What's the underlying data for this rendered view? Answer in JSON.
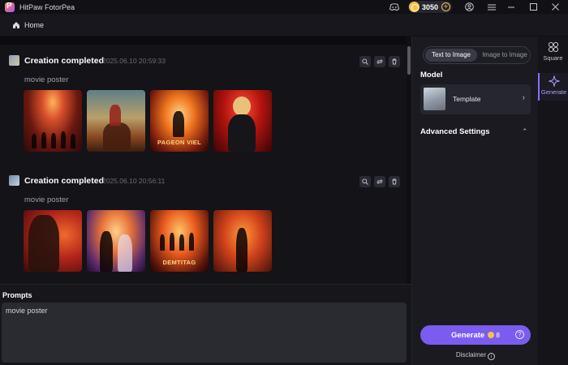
{
  "app": {
    "title": "HitPaw FotorPea",
    "coins": "3050"
  },
  "nav": {
    "home_label": "Home"
  },
  "feed": {
    "cards": [
      {
        "title": "Creation completed",
        "timestamp": "2025.06.10   20:59:33",
        "prompt": "movie poster",
        "images": [
          {
            "icon": "theater-stage-image",
            "caption": ""
          },
          {
            "icon": "cowboy-horse-image",
            "caption": ""
          },
          {
            "icon": "fire-poster-image",
            "caption": "PAGEON VIEL"
          },
          {
            "icon": "woman-red-jacket-image",
            "caption": ""
          }
        ]
      },
      {
        "title": "Creation completed",
        "timestamp": "2025.06.10   20:56:11",
        "prompt": "movie poster",
        "images": [
          {
            "icon": "man-portrait-image",
            "caption": ""
          },
          {
            "icon": "couple-sunset-image",
            "caption": ""
          },
          {
            "icon": "crowd-fire-image",
            "caption": "DEMTITAG"
          },
          {
            "icon": "woman-fire-image",
            "caption": ""
          }
        ]
      }
    ]
  },
  "prompts": {
    "label": "Prompts",
    "value": "movie poster"
  },
  "panel": {
    "modes": [
      "Text to Image",
      "Image to Image"
    ],
    "model_label": "Model",
    "model_name": "Template",
    "advanced_label": "Advanced Settings",
    "generate_label": "Generate",
    "generate_cost": "8",
    "disclaimer": "Disclaimer"
  },
  "rail": {
    "items": [
      "Square",
      "Generate"
    ]
  },
  "colors": {
    "accent": "#7b5cf0",
    "coin": "#f5c24b",
    "bg": "#141419"
  }
}
